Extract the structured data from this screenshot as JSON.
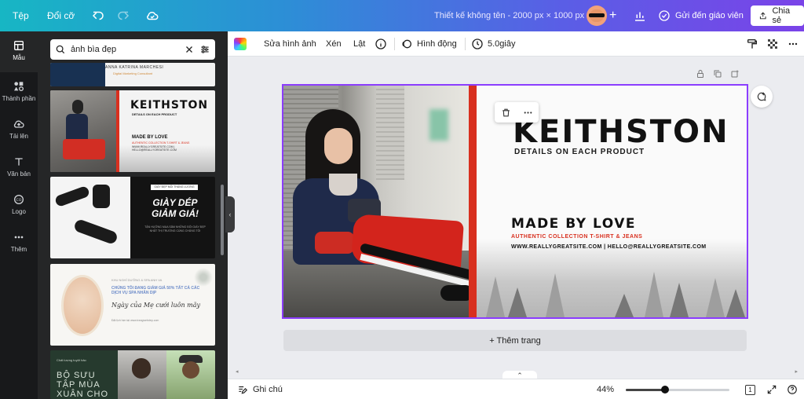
{
  "topbar": {
    "file_label": "Tệp",
    "resize_label": "Đổi cỡ",
    "doc_title": "Thiết kế không tên - 2000 px × 1000 px",
    "send_label": "Gửi đến giáo viên",
    "share_label": "Chia sẻ"
  },
  "rail": {
    "items": [
      {
        "label": "Mẫu",
        "icon": "template-icon"
      },
      {
        "label": "Thành phần",
        "icon": "elements-icon"
      },
      {
        "label": "Tải lên",
        "icon": "upload-icon"
      },
      {
        "label": "Văn bản",
        "icon": "text-icon"
      },
      {
        "label": "Logo",
        "icon": "logo-icon"
      },
      {
        "label": "Thêm",
        "icon": "more-icon"
      }
    ]
  },
  "panel": {
    "search_value": "ảnh bìa đẹp",
    "thumbs": {
      "t0": {
        "name": "ANNA KATRINA MARCHESI",
        "sub": "Digital Marketing Consultant"
      },
      "t1": {
        "title": "KEITHSTON",
        "sub1": "DETAILS ON EACH PRODUCT",
        "made": "MADE BY LOVE",
        "auth": "AUTHENTIC COLLECTION T-SHIRT & JEANS",
        "web": "WWW.REALLYGREATSITE.COM | HELLO@REALLYGREATSITE.COM"
      },
      "t2": {
        "tag": "GIÀY ĐẸP MỖI THÁNG LƯƠNG",
        "big": "GIÀY DÉP GIẢM GIÁ!",
        "small": "TẬN HƯỞNG MUA SẮM NHỮNG ĐÔI GIÀY ĐẸP NHẤT THỊ TRƯỜNG CÙNG CHÚNG TÔI"
      },
      "t3": {
        "l1": "KHU NGHỈ DƯỠNG & SPA ANH VA",
        "l2": "CHÚNG TÔI ĐANG GIẢM GIÁ 50% TẤT CẢ CÁC DỊCH VỤ SPA NHÂN DỊP",
        "l3": "Ngày của Mẹ cưới luôn mãy",
        "l4": "Đặt lịch hẹn tại www.trangwebdep.com"
      },
      "t4": {
        "tiny": "Chất lượng tuyệt hảo",
        "text": "BỘ SƯU TẬP MÙA XUÂN CHO NAM"
      }
    }
  },
  "editor_toolbar": {
    "edit_image": "Sửa hình ảnh",
    "crop": "Xén",
    "flip": "Lật",
    "animate": "Hình động",
    "duration": "5.0giây"
  },
  "design": {
    "title": "KEITHSTON",
    "sub1": "DETAILS ON EACH PRODUCT",
    "made": "MADE BY LOVE",
    "auth": "AUTHENTIC COLLECTION T-SHIRT & JEANS",
    "web": "WWW.REALLYGREATSITE.COM  |  HELLO@REALLYGREATSITE.COM",
    "accent": "#d8301f",
    "selection_color": "#8b3dff"
  },
  "add_page_label": "+ Thêm trang",
  "bottombar": {
    "notes_label": "Ghi chú",
    "zoom": "44%",
    "zoom_fraction": 0.38,
    "page_count": "1"
  }
}
